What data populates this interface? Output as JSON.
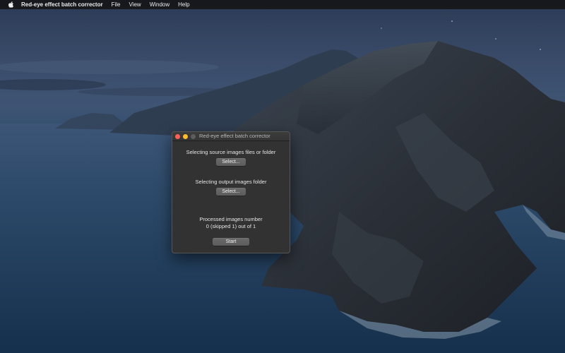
{
  "menubar": {
    "apple_icon": "apple-logo-icon",
    "app_name": "Red-eye effect batch corrector",
    "items": [
      "File",
      "View",
      "Window",
      "Help"
    ]
  },
  "window": {
    "title": "Red-eye effect batch corrector",
    "source_label": "Selecting source images files or folder",
    "source_button": "Select...",
    "output_label": "Selecting output images folder",
    "output_button": "Select...",
    "processed_label": "Processed images number",
    "processed_value": "0 (skipped 1) out of 1",
    "start_button": "Start"
  },
  "colors": {
    "close": "#fe5f57",
    "minimize": "#febc2e",
    "zoom_inactive": "#5d5d5d"
  }
}
